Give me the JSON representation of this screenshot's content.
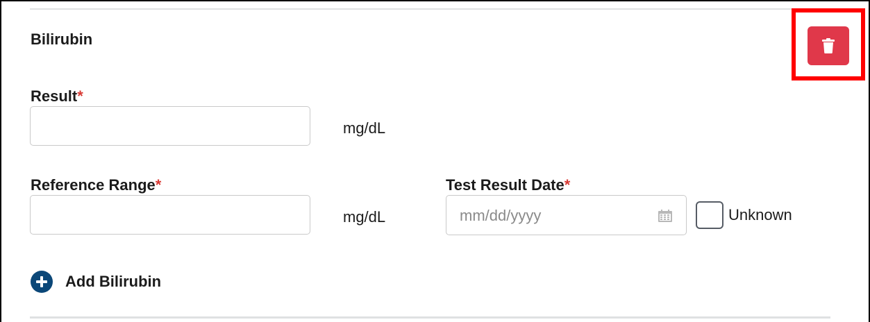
{
  "section": {
    "title": "Bilirubin"
  },
  "result": {
    "label": "Result",
    "required_marker": "*",
    "value": "",
    "unit": "mg/dL"
  },
  "reference_range": {
    "label": "Reference Range",
    "required_marker": "*",
    "value": "",
    "unit": "mg/dL"
  },
  "test_result_date": {
    "label": "Test Result Date",
    "required_marker": "*",
    "placeholder": "mm/dd/yyyy",
    "value": ""
  },
  "unknown_checkbox": {
    "label": "Unknown",
    "checked": false
  },
  "add_button": {
    "label": "Add Bilirubin",
    "icon": "plus-circle-icon"
  },
  "delete_button": {
    "icon": "trash-icon",
    "highlighted": true
  },
  "colors": {
    "delete": "#e0384a",
    "highlight": "#ff0000",
    "required": "#d83933",
    "add_icon": "#0b4778"
  }
}
